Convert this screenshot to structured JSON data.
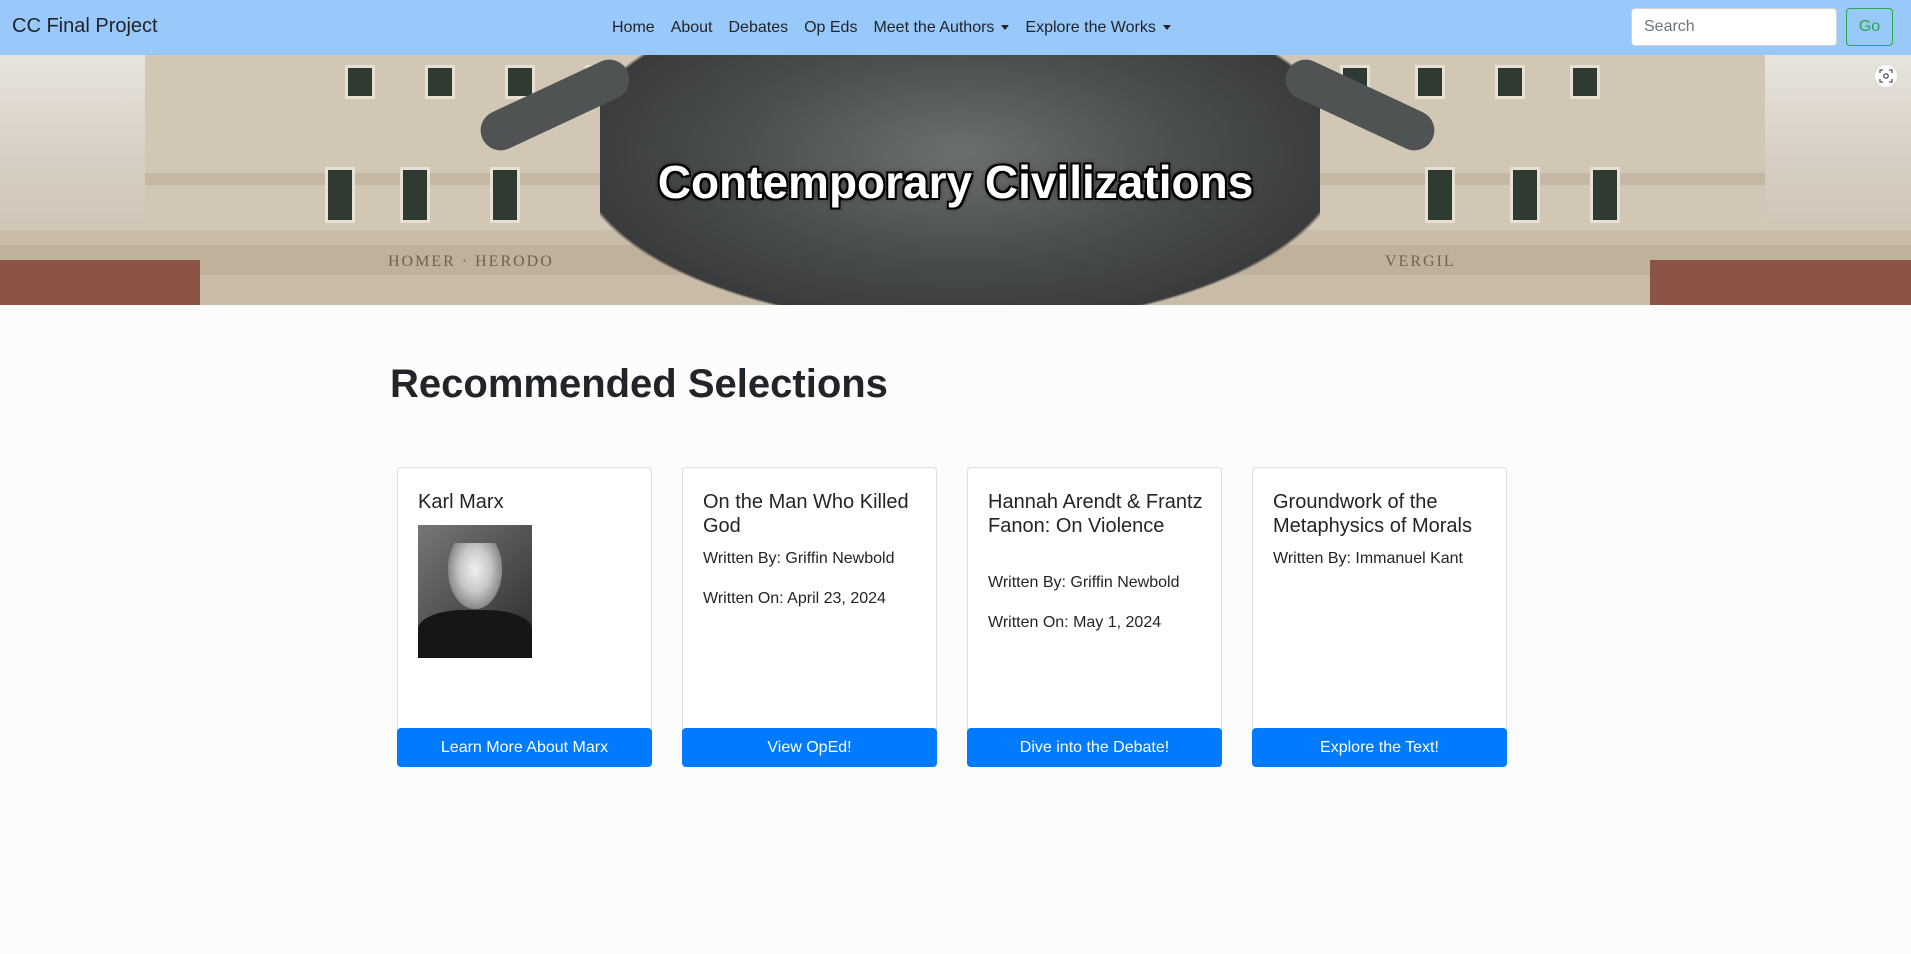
{
  "navbar": {
    "brand": "CC Final Project",
    "links": [
      "Home",
      "About",
      "Debates",
      "Op Eds"
    ],
    "dropdowns": [
      "Meet the Authors",
      "Explore the Works"
    ],
    "search_placeholder": "Search",
    "go_label": "Go"
  },
  "hero": {
    "title": "Contemporary Civilizations",
    "visible_inscriptions": [
      "HOMER · HERODO",
      "VERGIL"
    ]
  },
  "main": {
    "section_title": "Recommended Selections",
    "cards": [
      {
        "title": "Karl Marx",
        "has_image": true,
        "button": "Learn More About Marx"
      },
      {
        "title": "On the Man Who Killed God",
        "written_by": "Written By: Griffin Newbold",
        "written_on": "Written On: April 23, 2024",
        "button": "View OpEd!"
      },
      {
        "title": "Hannah Arendt & Frantz Fanon: On Violence",
        "written_by": "Written By: Griffin Newbold",
        "written_on": "Written On: May 1, 2024",
        "button": "Dive into the Debate!"
      },
      {
        "title": "Groundwork of the Metaphysics of Morals",
        "written_by": "Written By: Immanuel Kant",
        "button": "Explore the Text!"
      }
    ]
  },
  "colors": {
    "navbar_bg": "#99c9fb",
    "primary_button": "#007bff",
    "go_button": "#28a745"
  }
}
